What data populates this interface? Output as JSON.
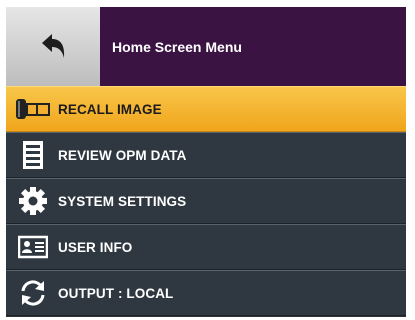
{
  "header": {
    "title": "Home Screen Menu",
    "back_icon": "back-arrow-icon"
  },
  "menu": {
    "items": [
      {
        "label": "RECALL IMAGE",
        "icon": "film-strip-icon",
        "active": true
      },
      {
        "label": "REVIEW OPM DATA",
        "icon": "document-list-icon",
        "active": false
      },
      {
        "label": "SYSTEM SETTINGS",
        "icon": "gear-icon",
        "active": false
      },
      {
        "label": "USER INFO",
        "icon": "id-card-icon",
        "active": false
      },
      {
        "label": "OUTPUT : LOCAL",
        "icon": "sync-arrows-icon",
        "active": false
      }
    ]
  },
  "colors": {
    "title_bar": "#3b1343",
    "active_item": "#f0a51b",
    "item_background": "#2f3840"
  }
}
